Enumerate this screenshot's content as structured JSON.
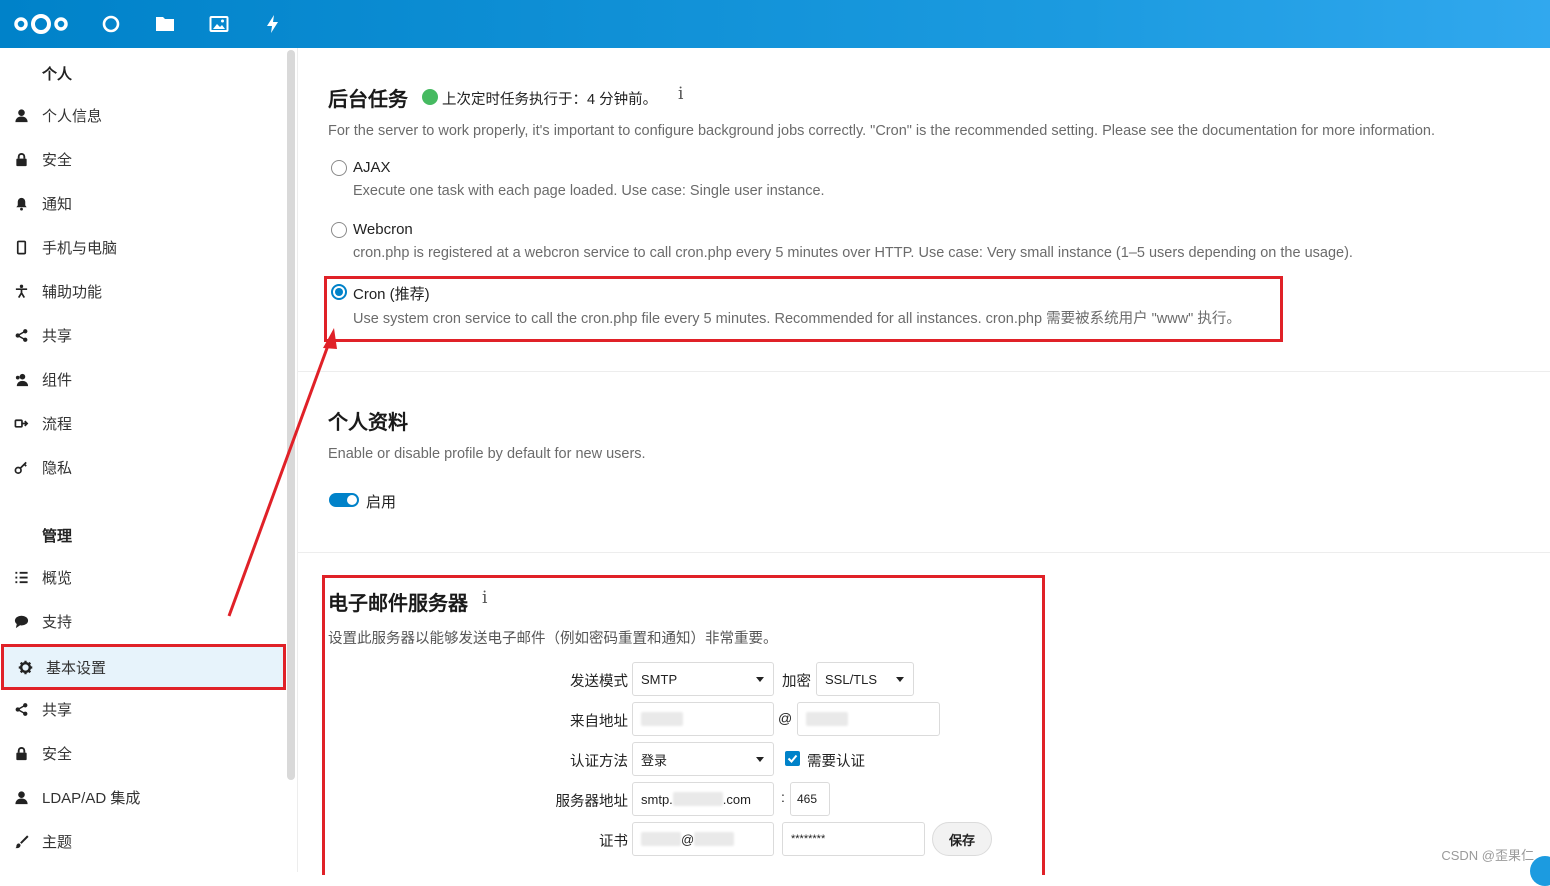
{
  "header": {
    "apps": [
      "dashboard-icon",
      "files-icon",
      "photos-icon",
      "activity-icon"
    ],
    "colors": {
      "bar": "#0082c9",
      "accent": "#0082c9"
    }
  },
  "sidebar": {
    "personal_caption": "个人",
    "personal_items": [
      {
        "label": "个人信息",
        "icon": "user-icon"
      },
      {
        "label": "安全",
        "icon": "lock-icon"
      },
      {
        "label": "通知",
        "icon": "bell-icon"
      },
      {
        "label": "手机与电脑",
        "icon": "phone-icon"
      },
      {
        "label": "辅助功能",
        "icon": "accessibility-icon"
      },
      {
        "label": "共享",
        "icon": "share-icon"
      },
      {
        "label": "组件",
        "icon": "group-icon"
      },
      {
        "label": "流程",
        "icon": "flow-icon"
      },
      {
        "label": "隐私",
        "icon": "key-icon"
      }
    ],
    "admin_caption": "管理",
    "admin_items": [
      {
        "label": "概览",
        "icon": "list-icon"
      },
      {
        "label": "支持",
        "icon": "chat-icon"
      },
      {
        "label": "基本设置",
        "icon": "gear-icon",
        "active": true
      },
      {
        "label": "共享",
        "icon": "share-icon"
      },
      {
        "label": "安全",
        "icon": "lock-icon"
      },
      {
        "label": "LDAP/AD 集成",
        "icon": "user-icon"
      },
      {
        "label": "主题",
        "icon": "brush-icon"
      }
    ]
  },
  "background_jobs": {
    "title": "后台任务",
    "status": "上次定时任务执行于：4 分钟前。",
    "status_color": "#46ba61",
    "description": "For the server to work properly, it's important to configure background jobs correctly. \"Cron\" is the recommended setting. Please see the documentation for more information.",
    "options": [
      {
        "label": "AJAX",
        "desc": "Execute one task with each page loaded. Use case: Single user instance.",
        "selected": false
      },
      {
        "label": "Webcron",
        "desc": "cron.php is registered at a webcron service to call cron.php every 5 minutes over HTTP. Use case: Very small instance (1–5 users depending on the usage).",
        "selected": false
      },
      {
        "label": "Cron (推荐)",
        "desc": "Use system cron service to call the cron.php file every 5 minutes. Recommended for all instances. cron.php 需要被系统用户 \"www\" 执行。",
        "selected": true
      }
    ]
  },
  "profile": {
    "title": "个人资料",
    "description": "Enable or disable profile by default for new users.",
    "toggle_label": "启用",
    "enabled": true
  },
  "mail": {
    "title": "电子邮件服务器",
    "description": "设置此服务器以能够发送电子邮件（例如密码重置和通知）非常重要。",
    "send_mode_label": "发送模式",
    "send_mode_value": "SMTP",
    "encryption_label": "加密",
    "encryption_value": "SSL/TLS",
    "from_label": "来自地址",
    "at_sign": "@",
    "auth_method_label": "认证方法",
    "auth_method_value": "登录",
    "auth_required_label": "需要认证",
    "auth_required": true,
    "server_label": "服务器地址",
    "server_prefix": "smtp.",
    "server_suffix": ".com",
    "colon": ":",
    "port": "465",
    "cert_label": "证书",
    "cert_user_suffix": "@",
    "password_mask": "********",
    "save_label": "保存"
  },
  "watermark": "CSDN @歪果仁"
}
